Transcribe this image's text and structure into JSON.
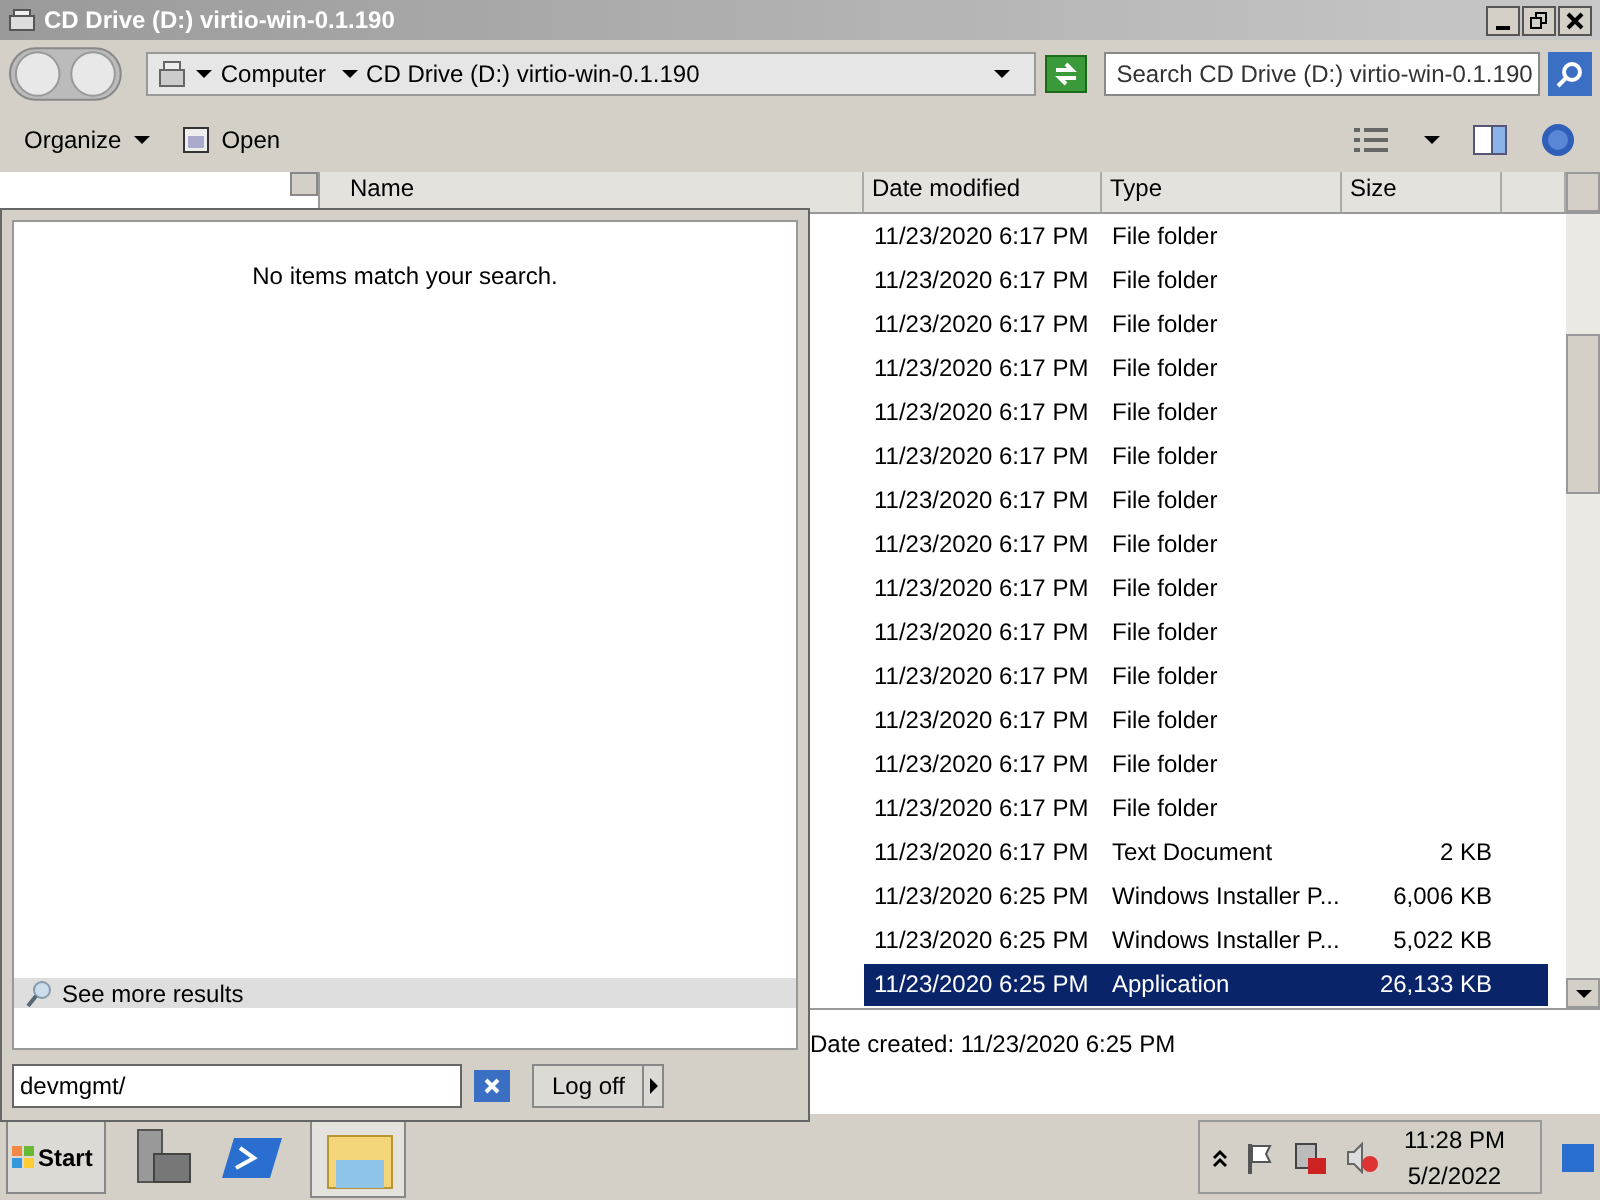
{
  "window": {
    "title": "CD Drive (D:) virtio-win-0.1.190"
  },
  "address": {
    "crumbs": [
      "Computer",
      "CD Drive (D:) virtio-win-0.1.190"
    ]
  },
  "search": {
    "placeholder": "Search CD Drive (D:) virtio-win-0.1.190"
  },
  "toolbar": {
    "items": [
      "Organize",
      "Open"
    ]
  },
  "columns": [
    "Name",
    "Date modified",
    "Type",
    "Size"
  ],
  "rows": [
    {
      "date": "11/23/2020 6:17 PM",
      "type": "File folder",
      "size": "",
      "selected": false
    },
    {
      "date": "11/23/2020 6:17 PM",
      "type": "File folder",
      "size": "",
      "selected": false
    },
    {
      "date": "11/23/2020 6:17 PM",
      "type": "File folder",
      "size": "",
      "selected": false
    },
    {
      "date": "11/23/2020 6:17 PM",
      "type": "File folder",
      "size": "",
      "selected": false
    },
    {
      "date": "11/23/2020 6:17 PM",
      "type": "File folder",
      "size": "",
      "selected": false
    },
    {
      "date": "11/23/2020 6:17 PM",
      "type": "File folder",
      "size": "",
      "selected": false
    },
    {
      "date": "11/23/2020 6:17 PM",
      "type": "File folder",
      "size": "",
      "selected": false
    },
    {
      "date": "11/23/2020 6:17 PM",
      "type": "File folder",
      "size": "",
      "selected": false
    },
    {
      "date": "11/23/2020 6:17 PM",
      "type": "File folder",
      "size": "",
      "selected": false
    },
    {
      "date": "11/23/2020 6:17 PM",
      "type": "File folder",
      "size": "",
      "selected": false
    },
    {
      "date": "11/23/2020 6:17 PM",
      "type": "File folder",
      "size": "",
      "selected": false
    },
    {
      "date": "11/23/2020 6:17 PM",
      "type": "File folder",
      "size": "",
      "selected": false
    },
    {
      "date": "11/23/2020 6:17 PM",
      "type": "File folder",
      "size": "",
      "selected": false
    },
    {
      "date": "11/23/2020 6:17 PM",
      "type": "File folder",
      "size": "",
      "selected": false
    },
    {
      "date": "11/23/2020 6:17 PM",
      "type": "Text Document",
      "size": "2 KB",
      "selected": false
    },
    {
      "date": "11/23/2020 6:25 PM",
      "type": "Windows Installer P...",
      "size": "6,006 KB",
      "selected": false
    },
    {
      "date": "11/23/2020 6:25 PM",
      "type": "Windows Installer P...",
      "size": "5,022 KB",
      "selected": false
    },
    {
      "date": "11/23/2020 6:25 PM",
      "type": "Application",
      "size": "26,133 KB",
      "selected": true
    }
  ],
  "details": {
    "text": "Date created:  11/23/2020 6:25 PM"
  },
  "start_menu": {
    "message": "No items match your search.",
    "more_results": "See more results",
    "search_value": "devmgmt/",
    "log_off": "Log off"
  },
  "taskbar": {
    "start": "Start",
    "time": "11:28 PM",
    "date": "5/2/2022"
  }
}
